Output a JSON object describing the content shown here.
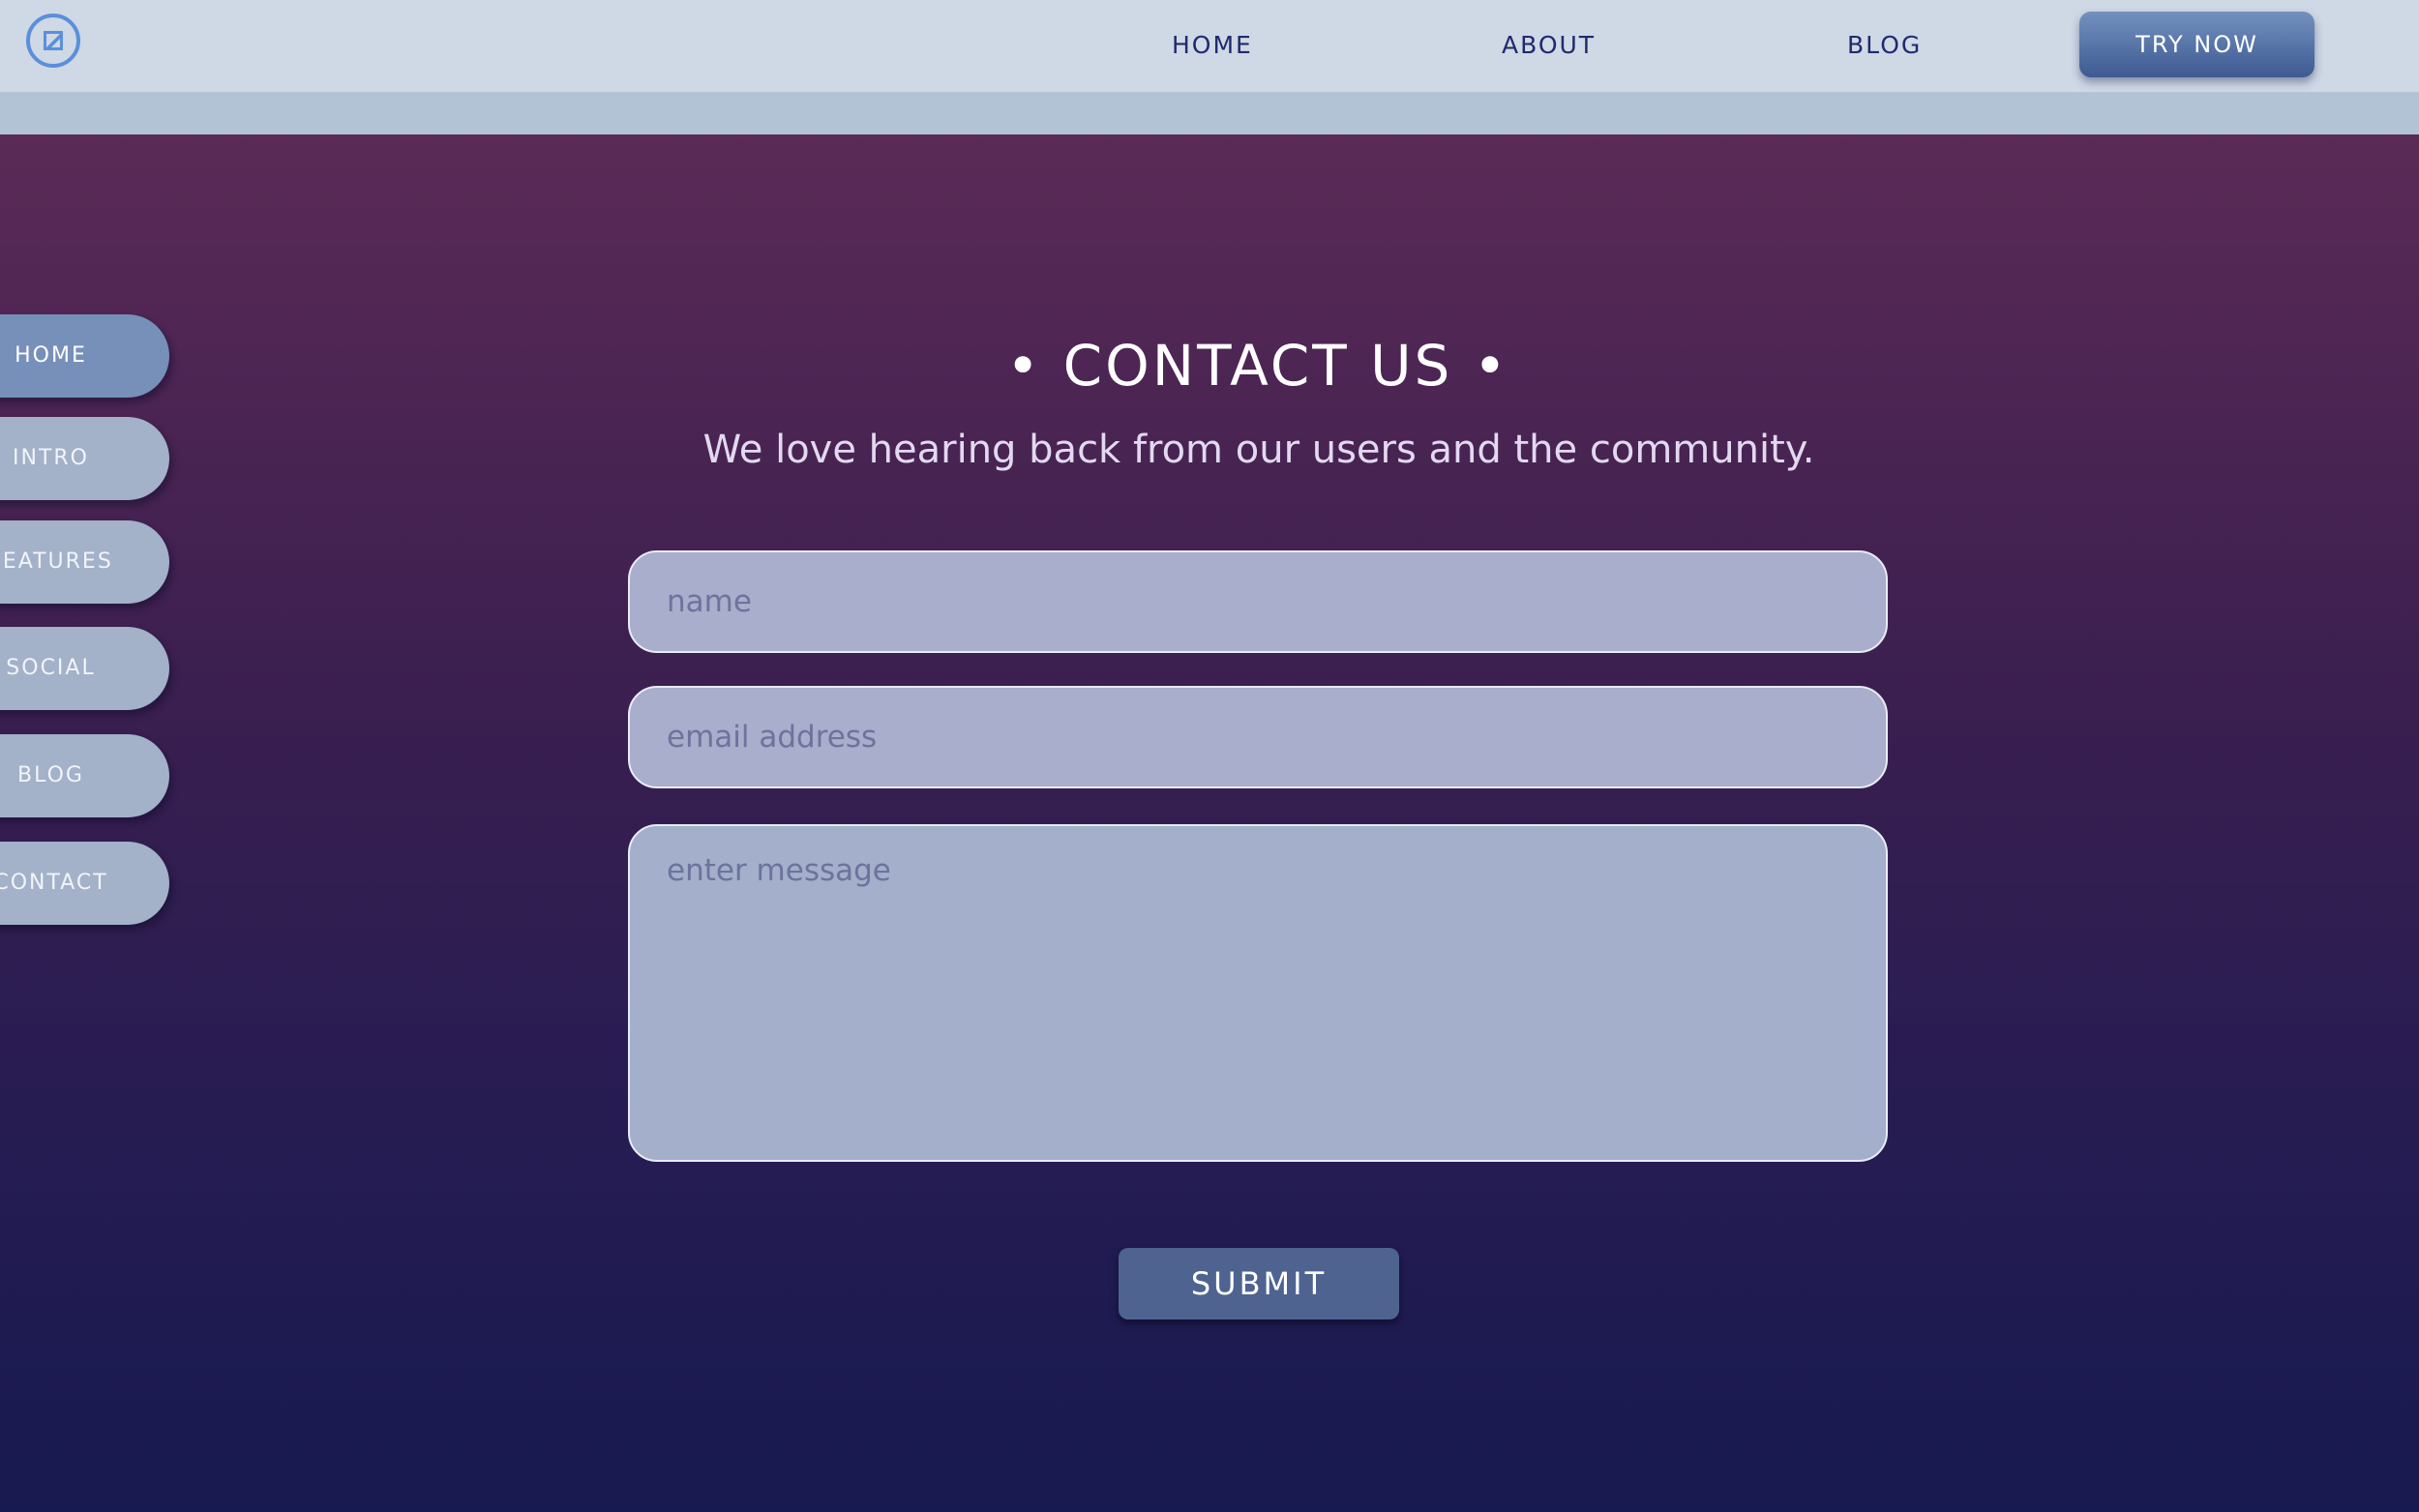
{
  "header": {
    "logo_icon": "logo-icon",
    "nav": {
      "home": "HOME",
      "about": "ABOUT",
      "blog": "BLOG"
    },
    "cta_label": "TRY NOW"
  },
  "side_nav": {
    "items": [
      {
        "label": "HOME",
        "active": true
      },
      {
        "label": "INTRO",
        "active": false
      },
      {
        "label": "FEATURES",
        "active": false
      },
      {
        "label": "SOCIAL",
        "active": false
      },
      {
        "label": "BLOG",
        "active": false
      },
      {
        "label": "CONTACT",
        "active": false
      }
    ]
  },
  "contact": {
    "title": "• CONTACT US •",
    "subtitle": "We love hearing back from our users and the community.",
    "name_placeholder": "name",
    "email_placeholder": "email address",
    "message_placeholder": "enter message",
    "submit_label": "SUBMIT"
  },
  "colors": {
    "topbar": "#cfd8e5",
    "band": "#b3c3d6",
    "gradient_top": "#5b2a56",
    "gradient_bottom": "#171a50",
    "accent": "#5b8fdc",
    "nav_text": "#1f2a6e",
    "field_bg": "#a8aecb",
    "submit_bg": "#4e6390"
  }
}
